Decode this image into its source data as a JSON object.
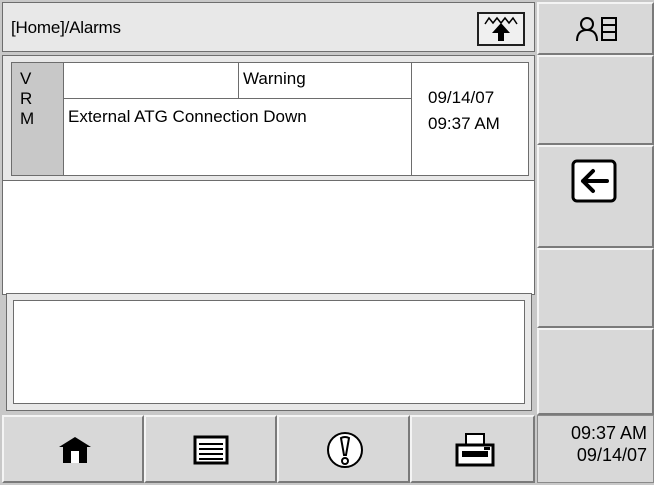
{
  "titlebar": {
    "breadcrumb": "[Home]/Alarms",
    "up_icon": "up-level-icon"
  },
  "alarm": {
    "category_letters": [
      "V",
      "R",
      "M"
    ],
    "severity": "Warning",
    "message": "External ATG Connection Down",
    "date": "09/14/07",
    "time": "09:37 AM",
    "device": ""
  },
  "sidebar": {
    "top_icon": "user-list-icon",
    "back_icon": "back-arrow-icon"
  },
  "bottom_nav": {
    "home_icon": "home-icon",
    "list_icon": "list-icon",
    "alarm_icon": "alarm-icon",
    "print_icon": "printer-icon"
  },
  "clock": {
    "time": "09:37 AM",
    "date": "09/14/07"
  },
  "colors": {
    "background": "#c8c8c8",
    "panel": "#e8e8e8",
    "field": "#ffffff",
    "border": "#6d6d6d"
  }
}
